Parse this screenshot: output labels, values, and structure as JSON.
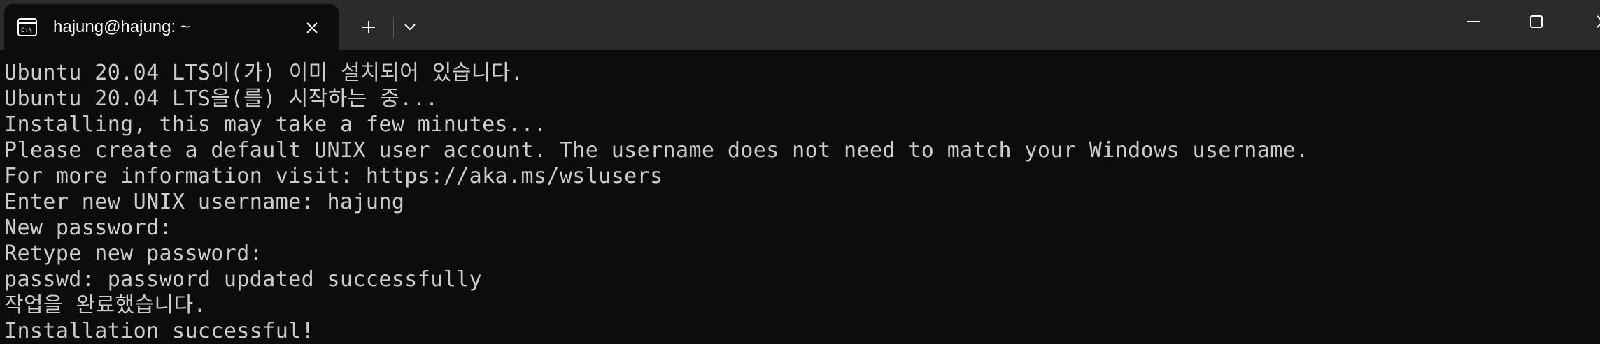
{
  "tab": {
    "title": "hajung@hajung: ~",
    "icon": "terminal-icon"
  },
  "titlebar": {
    "new_tab_icon": "plus-icon",
    "dropdown_icon": "chevron-down-icon",
    "minimize_icon": "minimize-icon",
    "maximize_icon": "maximize-icon",
    "close_icon": "close-icon"
  },
  "terminal": {
    "foreground": "#cccccc",
    "background": "#0c0c0c",
    "lines": [
      "Ubuntu 20.04 LTS이(가) 이미 설치되어 있습니다.",
      "Ubuntu 20.04 LTS을(를) 시작하는 중...",
      "Installing, this may take a few minutes...",
      "Please create a default UNIX user account. The username does not need to match your Windows username.",
      "For more information visit: https://aka.ms/wslusers",
      "Enter new UNIX username: hajung",
      "New password:",
      "Retype new password:",
      "passwd: password updated successfully",
      "작업을 완료했습니다.",
      "Installation successful!"
    ]
  }
}
